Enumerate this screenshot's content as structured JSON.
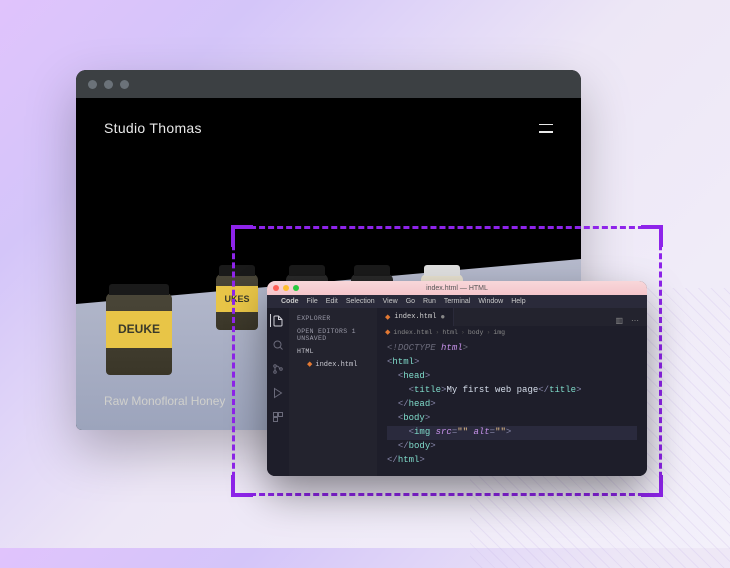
{
  "browser": {
    "site_title": "Studio Thomas",
    "caption": "Raw Monofloral Honey",
    "jar_labels": [
      "DEUKE",
      "UKES",
      "",
      "",
      ""
    ]
  },
  "vscode": {
    "window_title": "index.html — HTML",
    "menubar": {
      "app": "Code",
      "items": [
        "File",
        "Edit",
        "Selection",
        "View",
        "Go",
        "Run",
        "Terminal",
        "Window",
        "Help"
      ]
    },
    "sidebar": {
      "title": "EXPLORER",
      "sections": [
        "OPEN EDITORS  1 UNSAVED",
        "HTML"
      ],
      "file": "index.html"
    },
    "tab": {
      "label": "index.html",
      "icon": "html"
    },
    "breadcrumb": [
      "index.html",
      "html",
      "body",
      "img"
    ],
    "code": {
      "doctype_prefix": "<!",
      "doctype": "DOCTYPE",
      "doctype_arg": " html",
      "doctype_suffix": ">",
      "html_open": "html",
      "html_close": "html",
      "head_open": "head",
      "head_close": "head",
      "title_open": "title",
      "title_text": "My first web page",
      "title_close": "title",
      "body_open": "body",
      "body_close": "body",
      "img_tag": "img",
      "img_src_attr": "src",
      "img_src_val": "\"\"",
      "img_alt_attr": "alt",
      "img_alt_val": "\"\""
    }
  }
}
